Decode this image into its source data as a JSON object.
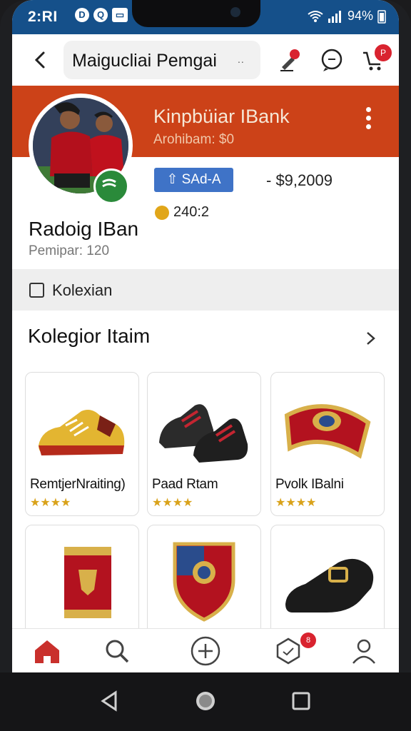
{
  "status_bar": {
    "time": "2:RI",
    "battery": "94%"
  },
  "app_bar": {
    "search_text": "Maigucliai Pemgai",
    "search_more": "..",
    "cart_badge": "P"
  },
  "profile": {
    "team_name": "Kinpbüiar IBank",
    "team_sub": "Arohibam: $0",
    "pill_label": "⇧ SAd-A",
    "price": "- $9,2009",
    "coins": "240:2",
    "user_name": "Radoig IBan",
    "user_sub": "Pemipar: 120"
  },
  "tab": {
    "label": "Kolexian"
  },
  "section": {
    "title": "Kolegior Itaim"
  },
  "items": [
    {
      "name": "RemtjerNraiting)",
      "stars": "★★★★",
      "icon": "sneaker-icon"
    },
    {
      "name": "Paad Rtam",
      "stars": "★★★★",
      "icon": "boots-icon"
    },
    {
      "name": "Pvolk IBalni",
      "stars": "★★★★",
      "icon": "bracelet-icon"
    },
    {
      "name": "",
      "stars": "",
      "icon": "wristband-icon"
    },
    {
      "name": "",
      "stars": "",
      "icon": "shield-crest-icon"
    },
    {
      "name": "",
      "stars": "",
      "icon": "shoe-icon"
    }
  ],
  "bottom_nav": {
    "badge": "8"
  },
  "colors": {
    "accent": "#cc4218",
    "status": "#15508a",
    "pill": "#3f73c7",
    "star": "#d9a21a",
    "home": "#c9302c"
  }
}
